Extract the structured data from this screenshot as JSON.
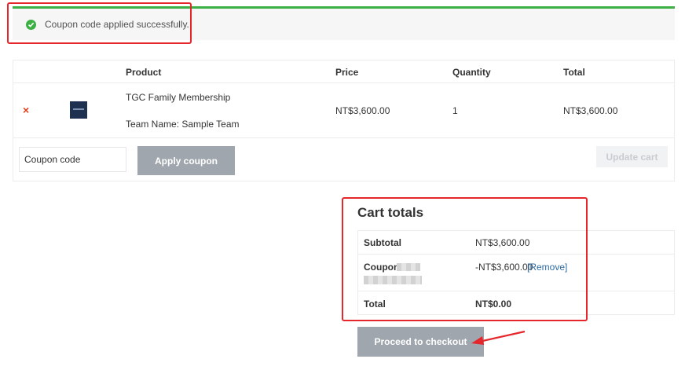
{
  "notice": {
    "message": "Coupon code applied successfully.",
    "icon": "check-circle-icon",
    "border_color": "#3cb043"
  },
  "cart_table": {
    "headers": {
      "product": "Product",
      "price": "Price",
      "quantity": "Quantity",
      "total": "Total"
    },
    "rows": [
      {
        "remove_symbol": "×",
        "product_name": "TGC Family Membership",
        "product_meta": "Team Name: Sample Team",
        "price": "NT$3,600.00",
        "quantity": "1",
        "total": "NT$3,600.00"
      }
    ]
  },
  "actions": {
    "coupon_placeholder": "Coupon code",
    "apply_label": "Apply coupon",
    "update_label": "Update cart"
  },
  "cart_totals": {
    "title": "Cart totals",
    "subtotal_label": "Subtotal",
    "subtotal_value": "NT$3,600.00",
    "coupon_label": "Coupon:",
    "coupon_value": "-NT$3,600.00",
    "coupon_remove": "[Remove]",
    "total_label": "Total",
    "total_value": "NT$0.00"
  },
  "checkout": {
    "label": "Proceed to checkout"
  },
  "colors": {
    "accent_red": "#e5262a",
    "button_gray": "#a0a6ad",
    "link_blue": "#2d6aa3"
  }
}
